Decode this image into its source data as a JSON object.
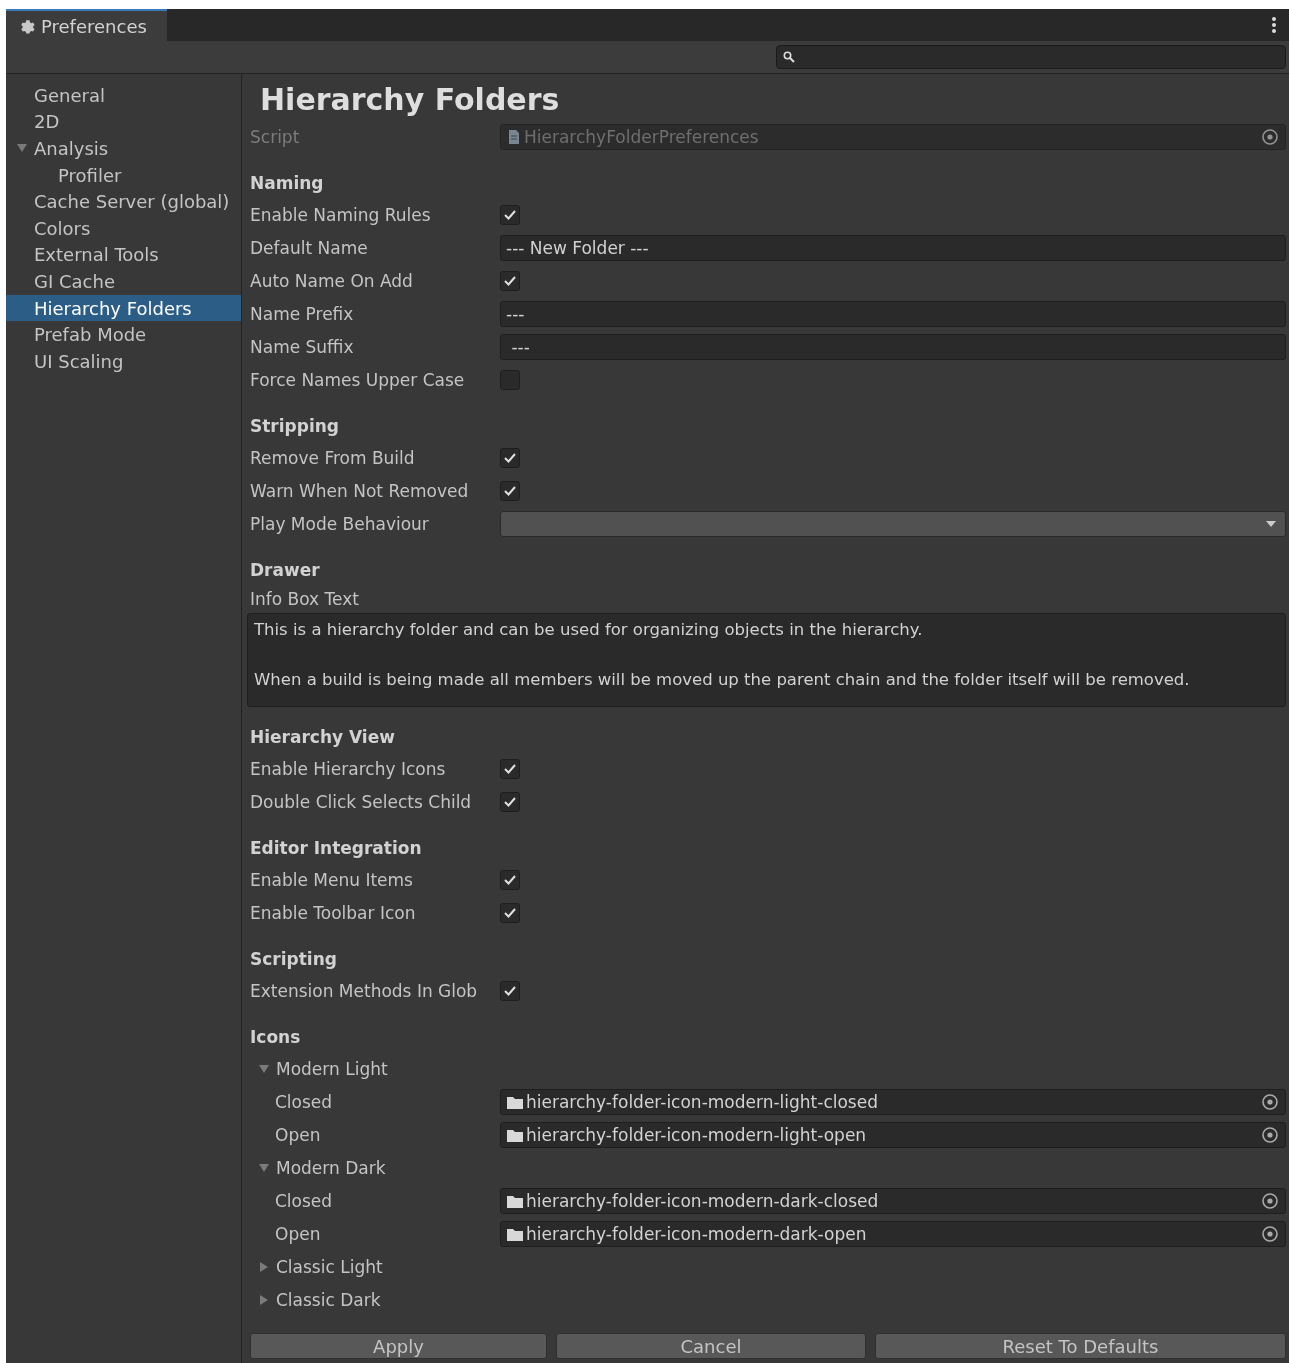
{
  "window": {
    "tab": "Preferences"
  },
  "sidebar": {
    "items": [
      {
        "label": "General",
        "selected": false
      },
      {
        "label": "2D",
        "selected": false
      },
      {
        "label": "Analysis",
        "selected": false,
        "expanded": true,
        "children": [
          {
            "label": "Profiler",
            "selected": false
          }
        ]
      },
      {
        "label": "Cache Server (global)",
        "selected": false
      },
      {
        "label": "Colors",
        "selected": false
      },
      {
        "label": "External Tools",
        "selected": false
      },
      {
        "label": "GI Cache",
        "selected": false
      },
      {
        "label": "Hierarchy Folders",
        "selected": true
      },
      {
        "label": "Prefab Mode",
        "selected": false
      },
      {
        "label": "UI Scaling",
        "selected": false
      }
    ]
  },
  "title": "Hierarchy Folders",
  "script": {
    "label": "Script",
    "value": "HierarchyFolderPreferences",
    "disabled": true
  },
  "sections": [
    {
      "title": "Naming",
      "fields": [
        {
          "kind": "checkbox",
          "label": "Enable Naming Rules",
          "checked": true
        },
        {
          "kind": "text",
          "label": "Default Name",
          "value": "--- New Folder ---"
        },
        {
          "kind": "checkbox",
          "label": "Auto Name On Add",
          "checked": true
        },
        {
          "kind": "text",
          "label": "Name Prefix",
          "value": "---"
        },
        {
          "kind": "text",
          "label": "Name Suffix",
          "value": " ---"
        },
        {
          "kind": "checkbox",
          "label": "Force Names Upper Case",
          "checked": false
        }
      ]
    },
    {
      "title": "Stripping",
      "fields": [
        {
          "kind": "checkbox",
          "label": "Remove From Build",
          "checked": true
        },
        {
          "kind": "checkbox",
          "label": "Warn When Not Removed",
          "checked": true
        },
        {
          "kind": "dropdown",
          "label": "Play Mode Behaviour"
        }
      ]
    },
    {
      "title": "Drawer",
      "fields": [
        {
          "kind": "textarea",
          "label": "Info Box Text",
          "value": "This is a hierarchy folder and can be used for organizing objects in the hierarchy.\n\nWhen a build is being made all members will be moved up the parent chain and the folder itself will be removed."
        }
      ]
    },
    {
      "title": "Hierarchy View",
      "fields": [
        {
          "kind": "checkbox",
          "label": "Enable Hierarchy Icons",
          "checked": true
        },
        {
          "kind": "checkbox",
          "label": "Double Click Selects Child",
          "checked": true
        }
      ]
    },
    {
      "title": "Editor Integration",
      "fields": [
        {
          "kind": "checkbox",
          "label": "Enable Menu Items",
          "checked": true
        },
        {
          "kind": "checkbox",
          "label": "Enable Toolbar Icon",
          "checked": true
        }
      ]
    },
    {
      "title": "Scripting",
      "fields": [
        {
          "kind": "checkbox",
          "label": "Extension Methods In Glob",
          "checked": true
        }
      ]
    },
    {
      "title": "Icons",
      "groups": [
        {
          "label": "Modern Light",
          "expanded": true,
          "children": [
            {
              "label": "Closed",
              "value": "hierarchy-folder-icon-modern-light-closed"
            },
            {
              "label": "Open",
              "value": "hierarchy-folder-icon-modern-light-open"
            }
          ]
        },
        {
          "label": "Modern Dark",
          "expanded": true,
          "children": [
            {
              "label": "Closed",
              "value": "hierarchy-folder-icon-modern-dark-closed"
            },
            {
              "label": "Open",
              "value": "hierarchy-folder-icon-modern-dark-open"
            }
          ]
        },
        {
          "label": "Classic Light",
          "expanded": false
        },
        {
          "label": "Classic Dark",
          "expanded": false
        }
      ]
    }
  ],
  "buttons": [
    "Apply",
    "Cancel",
    "Reset To Defaults"
  ]
}
